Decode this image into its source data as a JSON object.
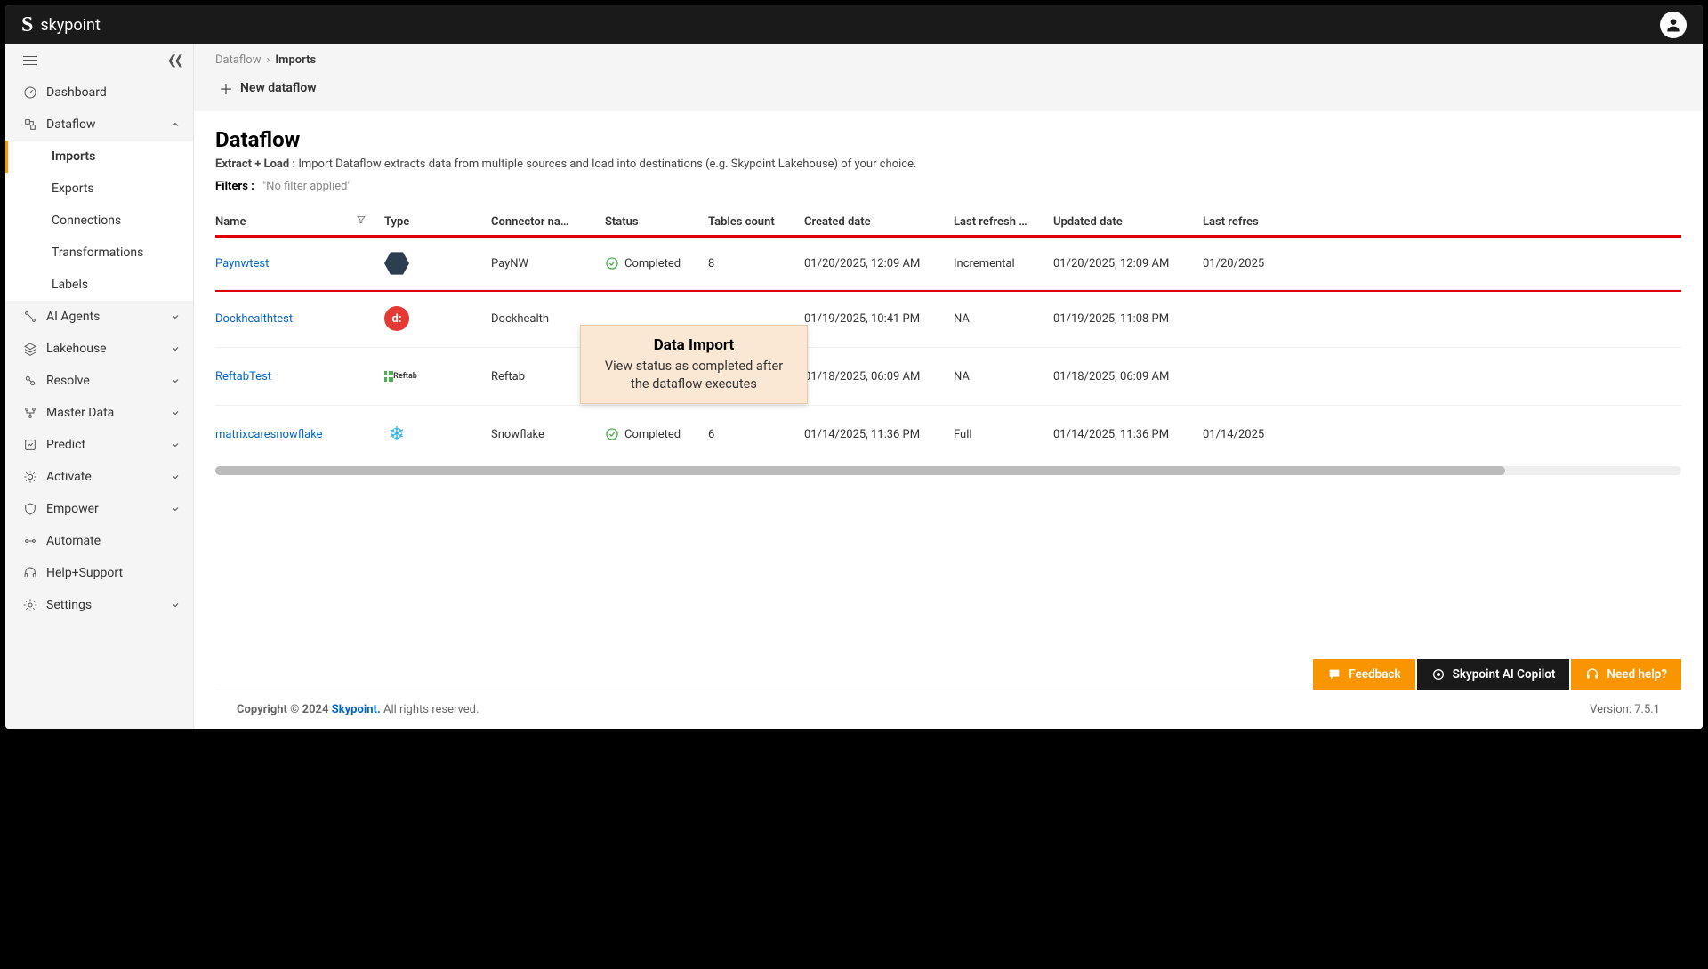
{
  "brand": {
    "name": "skypoint"
  },
  "sidebar": {
    "dashboard": "Dashboard",
    "dataflow": "Dataflow",
    "dataflow_children": [
      "Imports",
      "Exports",
      "Connections",
      "Transformations",
      "Labels"
    ],
    "ai_agents": "AI Agents",
    "lakehouse": "Lakehouse",
    "resolve": "Resolve",
    "master_data": "Master Data",
    "predict": "Predict",
    "activate": "Activate",
    "empower": "Empower",
    "automate": "Automate",
    "help": "Help+Support",
    "settings": "Settings"
  },
  "breadcrumb": {
    "parent": "Dataflow",
    "current": "Imports"
  },
  "toolbar": {
    "new_dataflow": "New dataflow"
  },
  "page": {
    "title": "Dataflow",
    "desc_bold": "Extract + Load :",
    "desc_text": " Import Dataflow extracts data from multiple sources and load into destinations (e.g. Skypoint Lakehouse) of your choice.",
    "filters_label": "Filters :",
    "filters_value": "\"No filter applied\""
  },
  "table": {
    "headers": {
      "name": "Name",
      "type": "Type",
      "connector": "Connector na…",
      "status": "Status",
      "tables": "Tables count",
      "created": "Created date",
      "refresh_type": "Last refresh …",
      "updated": "Updated date",
      "last_refresh": "Last refres"
    },
    "rows": [
      {
        "name": "Paynwtest",
        "connector": "PayNW",
        "status": "Completed",
        "tables": "8",
        "created": "01/20/2025, 12:09 AM",
        "refresh_type": "Incremental",
        "updated": "01/20/2025, 12:09 AM",
        "last_refresh": "01/20/2025",
        "icon": "hex",
        "highlighted": true
      },
      {
        "name": "Dockhealthtest",
        "connector": "Dockhealth",
        "status": "",
        "tables": "",
        "created": "01/19/2025, 10:41 PM",
        "refresh_type": "NA",
        "updated": "01/19/2025, 11:08 PM",
        "last_refresh": "",
        "icon": "dock"
      },
      {
        "name": "ReftabTest",
        "connector": "Reftab",
        "status": "",
        "tables": "",
        "created": "01/18/2025, 06:09 AM",
        "refresh_type": "NA",
        "updated": "01/18/2025, 06:09 AM",
        "last_refresh": "",
        "icon": "reftab"
      },
      {
        "name": "matrixcaresnowflake",
        "connector": "Snowflake",
        "status": "Completed",
        "tables": "6",
        "created": "01/14/2025, 11:36 PM",
        "refresh_type": "Full",
        "updated": "01/14/2025, 11:36 PM",
        "last_refresh": "01/14/2025",
        "icon": "snowflake"
      }
    ]
  },
  "callout": {
    "title": "Data Import",
    "text": "View status as completed after the dataflow executes"
  },
  "footer_actions": {
    "feedback": "Feedback",
    "copilot": "Skypoint AI Copilot",
    "need_help": "Need help?"
  },
  "footer": {
    "copyright_prefix": "Copyright © 2024 ",
    "copyright_link": "Skypoint.",
    "copyright_suffix": " All rights reserved.",
    "version": "Version: 7.5.1"
  }
}
